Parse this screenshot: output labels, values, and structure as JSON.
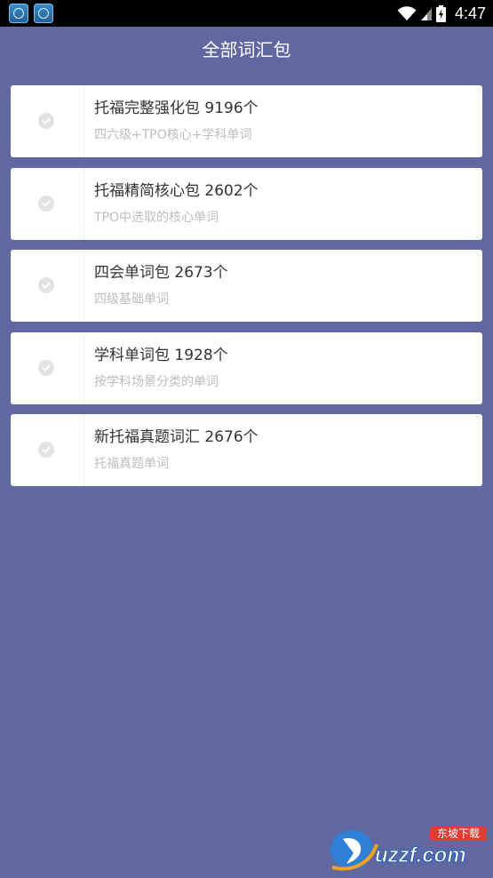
{
  "status_bar": {
    "time": "4:47",
    "notification_icons": [
      "app-notification-icon",
      "app-notification-icon"
    ],
    "indicators": [
      "wifi-icon",
      "signal-icon",
      "battery-icon"
    ]
  },
  "header": {
    "title": "全部词汇包"
  },
  "packs": [
    {
      "title": "托福完整强化包 9196个",
      "subtitle": "四六级+TPO核心+学科单词"
    },
    {
      "title": "托福精简核心包 2602个",
      "subtitle": "TPO中选取的核心单词"
    },
    {
      "title": "四会单词包 2673个",
      "subtitle": "四级基础单词"
    },
    {
      "title": "学科单词包 1928个",
      "subtitle": "按学科场景分类的单词"
    },
    {
      "title": "新托福真题词汇 2676个",
      "subtitle": "托福真题单词"
    }
  ],
  "watermark": {
    "text": "uzzf.com",
    "badge": "东坡下载"
  },
  "colors": {
    "background": "#6168a1",
    "card": "#ffffff",
    "status_bar": "#000000"
  }
}
